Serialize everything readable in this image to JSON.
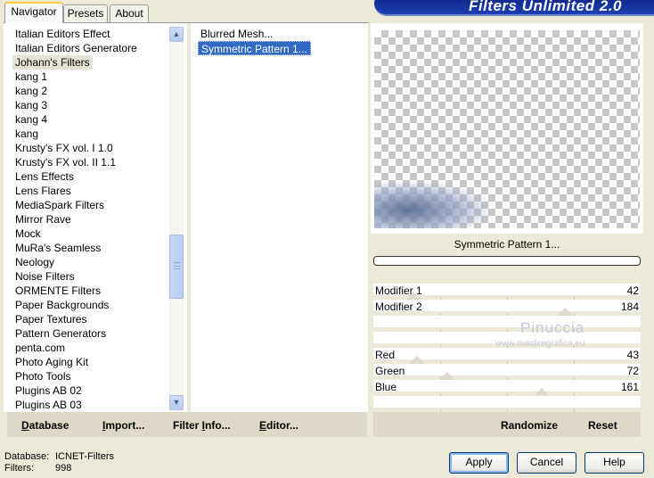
{
  "banner": {
    "title": "Filters Unlimited 2.0"
  },
  "tabs": [
    "Navigator",
    "Presets",
    "About"
  ],
  "categories": [
    "Italian Editors Effect",
    "Italian Editors Generatore",
    "Johann's Filters",
    "kang 1",
    "kang 2",
    "kang 3",
    "kang 4",
    "kang",
    "Krusty's FX vol. I 1.0",
    "Krusty's FX vol. II 1.1",
    "Lens Effects",
    "Lens Flares",
    "MediaSpark Filters",
    "Mirror Rave",
    "Mock",
    "MuRa's Seamless",
    "Neology",
    "Noise Filters",
    "ORMENTE Filters",
    "Paper Backgrounds",
    "Paper Textures",
    "Pattern Generators",
    "penta.com",
    "Photo Aging Kit",
    "Photo Tools",
    "Plugins AB 02",
    "Plugins AB 03"
  ],
  "filters": [
    "Blurred Mesh...",
    "Symmetric Pattern 1..."
  ],
  "preview": {
    "filter_name": "Symmetric Pattern 1..."
  },
  "params": [
    {
      "label": "Modifier 1",
      "value": "42"
    },
    {
      "label": "Modifier 2",
      "value": "184"
    },
    {
      "label": "",
      "value": ""
    },
    {
      "label": "",
      "value": ""
    },
    {
      "label": "Red",
      "value": "43"
    },
    {
      "label": "Green",
      "value": "72"
    },
    {
      "label": "Blue",
      "value": "161"
    },
    {
      "label": "",
      "value": ""
    }
  ],
  "watermark": {
    "line1": "Pinuccia",
    "line2": "www.maidiregrafica.eu"
  },
  "left_bar": {
    "database_first": "D",
    "database_rest": "atabase",
    "import_first": "I",
    "import_rest": "mport...",
    "filterinfo_pre": "Filter ",
    "filterinfo_u": "I",
    "filterinfo_rest": "nfo...",
    "editor_first": "E",
    "editor_rest": "ditor..."
  },
  "right_bar": {
    "randomize": "Randomize",
    "reset": "Reset"
  },
  "status": {
    "database_label": "Database:",
    "database_value": "ICNET-Filters",
    "filters_label": "Filters:",
    "filters_value": "998"
  },
  "buttons": {
    "apply": "Apply",
    "cancel": "Cancel",
    "help": "Help"
  },
  "icons": {
    "scroll_up": "arrow-up-icon",
    "scroll_down": "arrow-down-icon"
  },
  "colors": {
    "selection": "#316ac5",
    "banner": "#0a1f7a"
  }
}
